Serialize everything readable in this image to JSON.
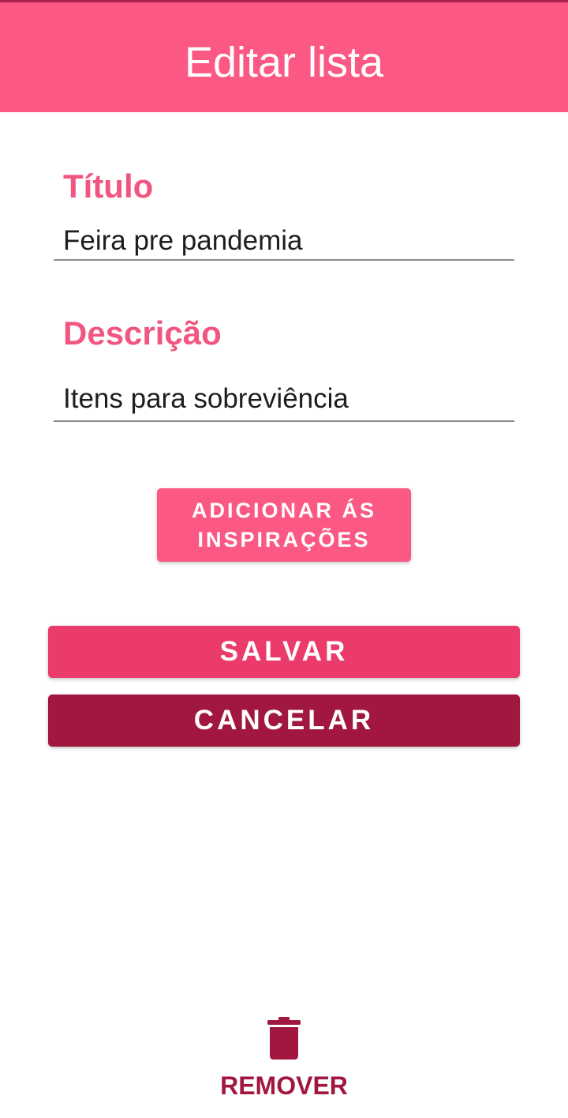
{
  "app_bar": {
    "title": "Editar lista",
    "color": "#fb5883"
  },
  "form": {
    "title_label": "Título",
    "title_value": "Feira pre pandemia",
    "description_label": "Descrição",
    "description_value": "Itens para sobreviência"
  },
  "buttons": {
    "inspire_label": "ADICIONAR ÁS INSPIRAÇÕES",
    "save_label": "SALVAR",
    "cancel_label": "CANCELAR"
  },
  "remove": {
    "icon": "trash-icon",
    "label": "REMOVER"
  },
  "colors": {
    "accent": "#fb5883",
    "label": "#f0567f",
    "save": "#eb3b6b",
    "cancel": "#a1173f"
  }
}
